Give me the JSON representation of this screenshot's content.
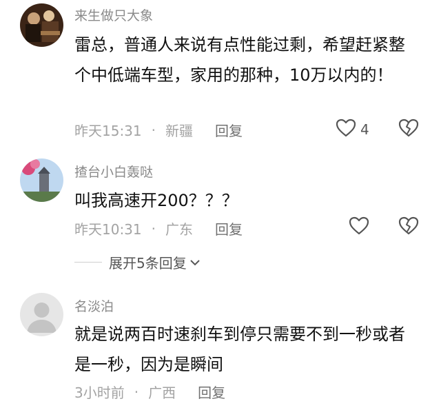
{
  "comments": [
    {
      "username": "来生做只大象",
      "content": "雷总，普通人来说有点性能过剩，希望赶紧整个中低端车型，家用的那种，10万以内的！",
      "time": "昨天15:31",
      "location": "新疆",
      "reply_label": "回复",
      "like_count": "4"
    },
    {
      "username": "揸台小白轰哒",
      "content": "叫我高速开200？？？",
      "time": "昨天10:31",
      "location": "广东",
      "reply_label": "回复",
      "like_count": ""
    },
    {
      "username": "名淡泊",
      "content": "就是说两百时速刹车到停只需要不到一秒或者是一秒，因为是瞬间",
      "time": "3小时前",
      "location": "广西",
      "reply_label": "回复",
      "like_count": ""
    }
  ],
  "expand_replies": {
    "label": "展开5条回复"
  },
  "icons": {
    "like": "heart-outline-icon",
    "dislike": "broken-heart-icon",
    "expand": "chevron-down-icon"
  }
}
